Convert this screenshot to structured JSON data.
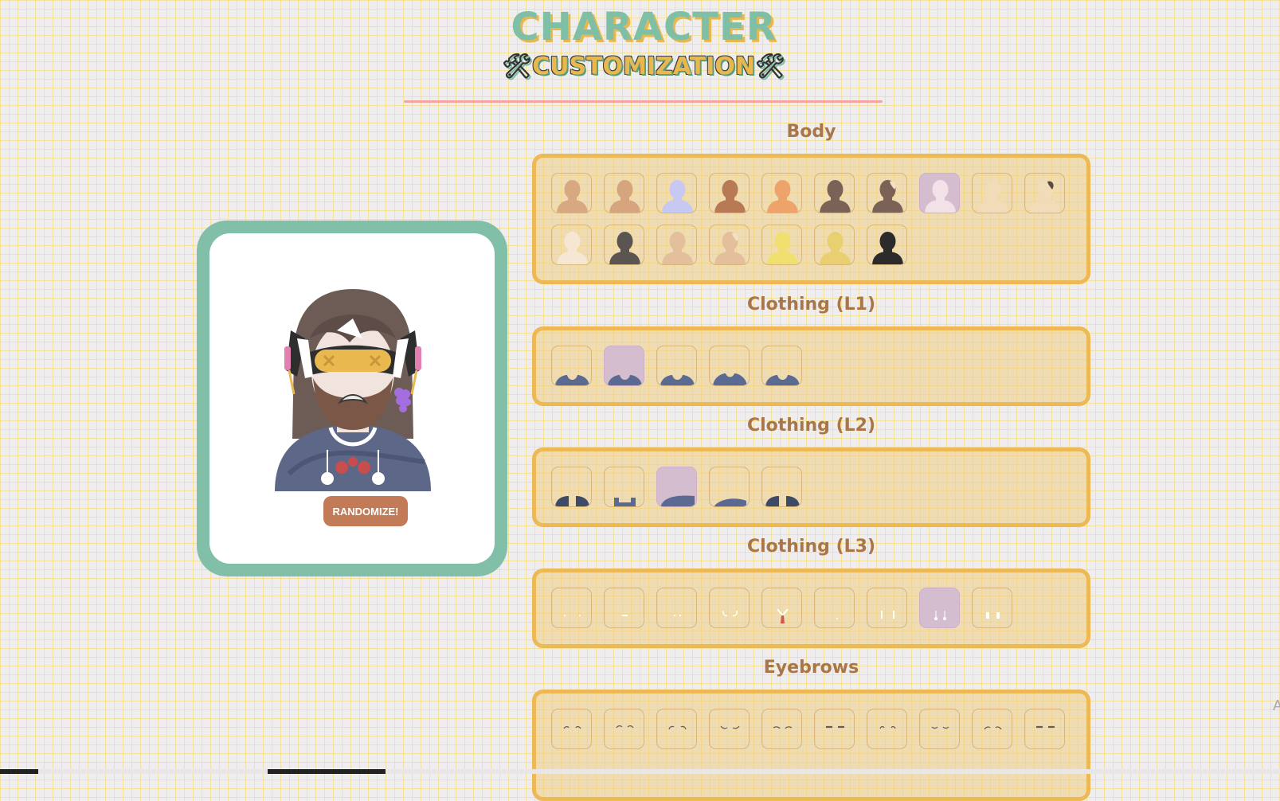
{
  "header": {
    "title": "CHARACTER",
    "subtitle": "CUSTOMIZATION",
    "tool_icon": "🛠"
  },
  "preview": {
    "randomize_label": "RANDOMIZE!"
  },
  "colors": {
    "teal": "#82bfa8",
    "gold": "#ecb955",
    "section_title": "#a9764a",
    "selected": "#d5bdd0",
    "button": "#c27a57",
    "clothing": "#5a6a93"
  },
  "sections": [
    {
      "title": "Body",
      "kind": "body",
      "selected_index": 7,
      "options": [
        {
          "skin": "#d8a880",
          "hair": ""
        },
        {
          "skin": "#d6a57d",
          "hair": ""
        },
        {
          "skin": "#c7c9f2",
          "hair": ""
        },
        {
          "skin": "#b77a55",
          "hair": ""
        },
        {
          "skin": "#eea36b",
          "hair": ""
        },
        {
          "skin": "#7b6257",
          "hair": ""
        },
        {
          "skin": "#7b6257",
          "hair": "#f4e1c5"
        },
        {
          "skin": "#f3e1e8",
          "hair": ""
        },
        {
          "skin": "#f2dbb8",
          "hair": ""
        },
        {
          "skin": "#f2dbb8",
          "hair": "#5a4a44"
        },
        {
          "skin": "#f6e7d4",
          "hair": ""
        },
        {
          "skin": "#5a5550",
          "hair": ""
        },
        {
          "skin": "#e3c09b",
          "hair": ""
        },
        {
          "skin": "#e3c09b",
          "hair": "#f4e1c5"
        },
        {
          "skin": "#f0e070",
          "hair": ""
        },
        {
          "skin": "#e8d070",
          "hair": ""
        },
        {
          "skin": "#2b2b2b",
          "hair": ""
        }
      ]
    },
    {
      "title": "Clothing (L1)",
      "kind": "cloth1",
      "selected_index": 1,
      "options": [
        {
          "v": 1
        },
        {
          "v": 2
        },
        {
          "v": 3
        },
        {
          "v": 4
        },
        {
          "v": 5
        }
      ]
    },
    {
      "title": "Clothing (L2)",
      "kind": "cloth2",
      "selected_index": 2,
      "options": [
        {
          "v": 1
        },
        {
          "v": 2
        },
        {
          "v": 3
        },
        {
          "v": 4
        },
        {
          "v": 5
        }
      ]
    },
    {
      "title": "Clothing (L3)",
      "kind": "cloth3",
      "selected_index": 7,
      "options": [
        {
          "v": 1
        },
        {
          "v": 2
        },
        {
          "v": 3
        },
        {
          "v": 4
        },
        {
          "v": 5
        },
        {
          "v": 6
        },
        {
          "v": 7
        },
        {
          "v": 8
        },
        {
          "v": 9
        }
      ]
    },
    {
      "title": "Eyebrows",
      "kind": "brows",
      "selected_index": -1,
      "options": [
        {
          "v": 1
        },
        {
          "v": 2
        },
        {
          "v": 3
        },
        {
          "v": 4
        },
        {
          "v": 5
        },
        {
          "v": 6
        },
        {
          "v": 7
        },
        {
          "v": 8
        },
        {
          "v": 9
        },
        {
          "v": 10
        }
      ]
    }
  ],
  "edge_text": "A"
}
